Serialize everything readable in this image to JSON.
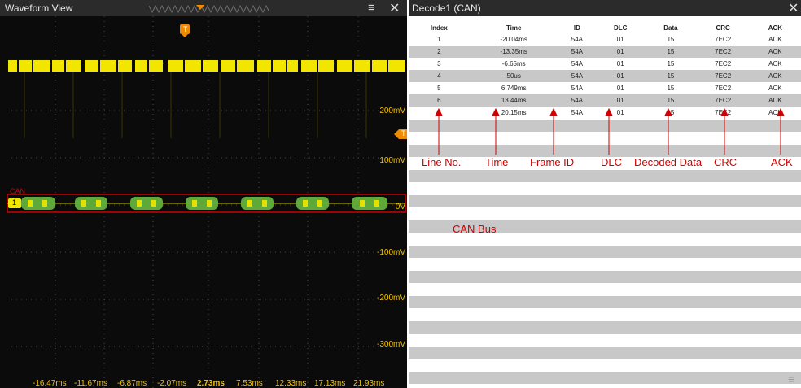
{
  "wave_panel": {
    "title": "Waveform View",
    "trigger_marker": "T",
    "trigger_level_marker": "T",
    "channel_label": "CAN",
    "channel_marker": "1",
    "voltage_labels": [
      "200mV",
      "100mV",
      "0V",
      "-100mV",
      "-200mV",
      "-300mV"
    ],
    "time_ticks": [
      "-16.47ms",
      "-11.67ms",
      "-6.87ms",
      "-2.07ms",
      "2.73ms",
      "7.53ms",
      "12.33ms",
      "17.13ms",
      "21.93ms"
    ],
    "colors": {
      "trace": "#f2e600",
      "decode": "#5fa83a",
      "annotation": "#d10000",
      "background": "#0b0b0b"
    }
  },
  "annotations": {
    "line_no": "Line No.",
    "time": "Time",
    "frame_id": "Frame ID",
    "dlc": "DLC",
    "decoded_data": "Decoded Data",
    "crc": "CRC",
    "ack": "ACK",
    "can_bus": "CAN Bus"
  },
  "decode_panel": {
    "title": "Decode1 (CAN)",
    "columns": [
      "Index",
      "Time",
      "ID",
      "DLC",
      "Data",
      "CRC",
      "ACK"
    ],
    "rows": [
      [
        "1",
        "-20.04ms",
        "54A",
        "01",
        "15",
        "7EC2",
        "ACK"
      ],
      [
        "2",
        "-13.35ms",
        "54A",
        "01",
        "15",
        "7EC2",
        "ACK"
      ],
      [
        "3",
        "-6.65ms",
        "54A",
        "01",
        "15",
        "7EC2",
        "ACK"
      ],
      [
        "4",
        "50us",
        "54A",
        "01",
        "15",
        "7EC2",
        "ACK"
      ],
      [
        "5",
        "6.749ms",
        "54A",
        "01",
        "15",
        "7EC2",
        "ACK"
      ],
      [
        "6",
        "13.44ms",
        "54A",
        "01",
        "15",
        "7EC2",
        "ACK"
      ],
      [
        "7",
        "20.15ms",
        "54A",
        "01",
        "15",
        "7EC2",
        "ACK"
      ]
    ]
  },
  "icons": {
    "menu": "menu-icon",
    "close": "close-icon",
    "corner": "list-settings-icon"
  }
}
